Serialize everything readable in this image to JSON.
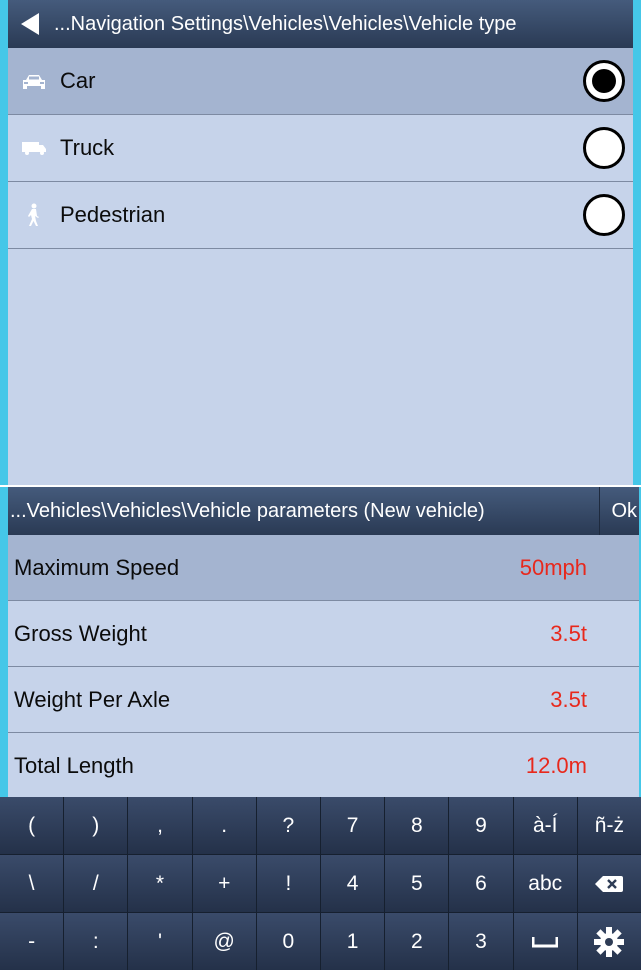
{
  "top": {
    "title": "...Navigation Settings\\Vehicles\\Vehicles\\Vehicle type",
    "options": [
      {
        "label": "Car",
        "icon": "car-icon",
        "selected": true
      },
      {
        "label": "Truck",
        "icon": "truck-icon",
        "selected": false
      },
      {
        "label": "Pedestrian",
        "icon": "pedestrian-icon",
        "selected": false
      }
    ]
  },
  "bottom": {
    "title": "...Vehicles\\Vehicles\\Vehicle parameters (New vehicle)",
    "ok_label": "Ok",
    "params": [
      {
        "name": "Maximum Speed",
        "value": "50mph",
        "selected": true
      },
      {
        "name": "Gross Weight",
        "value": "3.5t",
        "selected": false
      },
      {
        "name": "Weight Per Axle",
        "value": "3.5t",
        "selected": false
      },
      {
        "name": "Total Length",
        "value": "12.0m",
        "selected": false
      }
    ]
  },
  "keyboard": {
    "rows": [
      [
        "(",
        ")",
        ",",
        ".",
        "?",
        "7",
        "8",
        "9",
        "à-Í",
        "ñ-ż"
      ],
      [
        "\\",
        "/",
        "*",
        "+",
        "!",
        "4",
        "5",
        "6",
        "abc",
        "backspace-icon"
      ],
      [
        "-",
        ":",
        "'",
        "@",
        "0",
        "1",
        "2",
        "3",
        "space-icon",
        "gear-icon"
      ]
    ]
  },
  "colors": {
    "accent_border": "#45c7e8",
    "panel_bg": "#c6d3ea",
    "selected_row": "#a4b4d0",
    "value_red": "#e8281c",
    "titlebar": "#344866",
    "keyboard": "#2e3c55"
  }
}
